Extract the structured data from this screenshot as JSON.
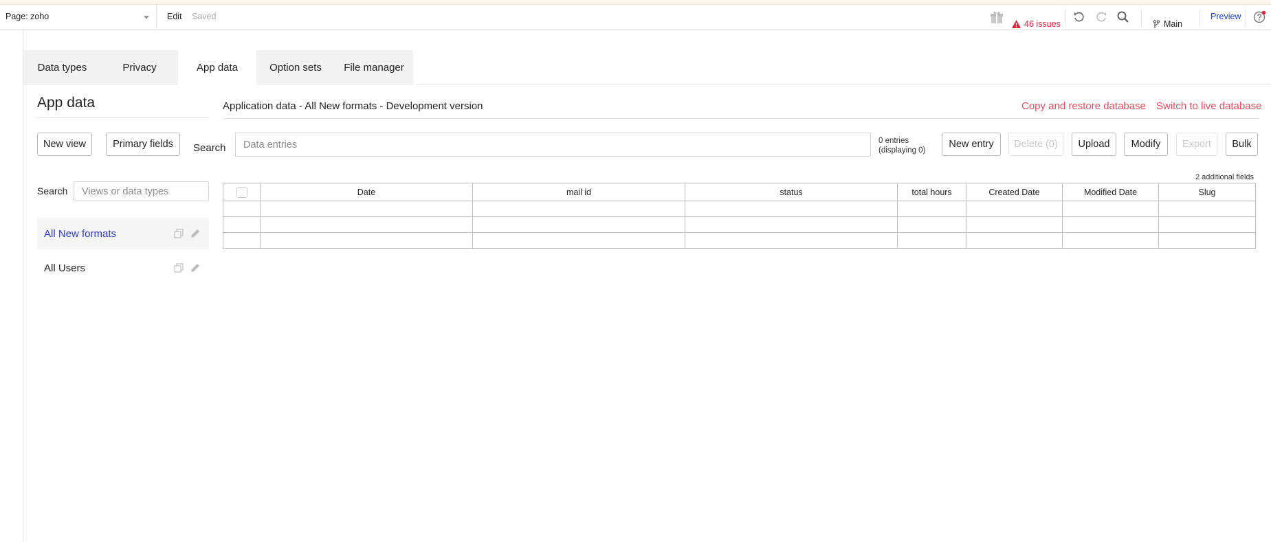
{
  "topbar": {
    "page_label": "Page: zoho",
    "edit": "Edit",
    "saved": "Saved",
    "issues": "46 issues",
    "branch": "Main",
    "preview": "Preview"
  },
  "tabs": [
    {
      "label": "Data types"
    },
    {
      "label": "Privacy"
    },
    {
      "label": "App data",
      "active": true
    },
    {
      "label": "Option sets"
    },
    {
      "label": "File manager"
    }
  ],
  "left_panel": {
    "title": "App data",
    "new_view": "New view",
    "primary_fields": "Primary fields",
    "search_label": "Search",
    "search_placeholder": "Views or data types",
    "views": [
      {
        "label": "All New formats",
        "selected": true
      },
      {
        "label": "All Users"
      }
    ]
  },
  "main": {
    "title": "Application data - All New formats - Development version",
    "copy_restore": "Copy and restore database",
    "switch_live": "Switch to live database",
    "search_label": "Search",
    "search_placeholder": "Data entries",
    "entries_line1": "0 entries",
    "entries_line2": "(displaying 0)",
    "buttons": {
      "new_entry": "New entry",
      "delete": "Delete (0)",
      "upload": "Upload",
      "modify": "Modify",
      "export": "Export",
      "bulk": "Bulk"
    },
    "additional_fields": "2 additional fields",
    "columns": [
      "Date",
      "mail id",
      "status",
      "total hours",
      "Created Date",
      "Modified Date",
      "Slug"
    ]
  },
  "colors": {
    "accent_blue": "#2a39c4",
    "link_red": "#e84c5c",
    "issues_red": "#e0243b"
  }
}
